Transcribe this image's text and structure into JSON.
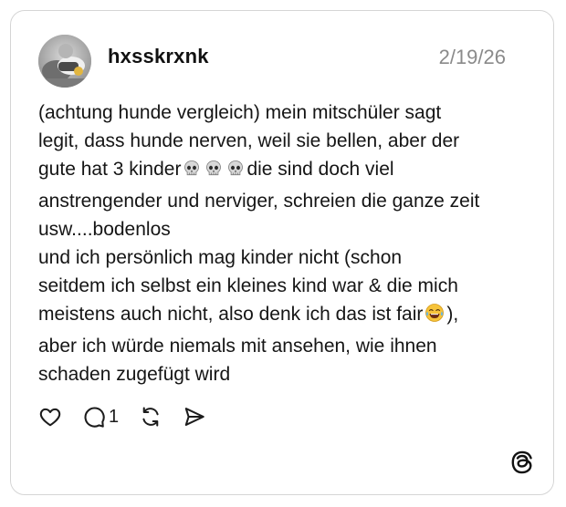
{
  "post": {
    "username": "hxsskrxnk",
    "date": "2/19/26",
    "body": {
      "line1": "(achtung hunde vergleich) mein mitschüler sagt",
      "line2": "legit, dass hunde nerven, weil sie bellen, aber der",
      "line3_before": "gute hat 3 kinder",
      "line3_after": "die sind doch viel",
      "line4": "anstrengender und nerviger, schreien die ganze zeit",
      "line5": "usw....bodenlos",
      "line6": "und ich persönlich mag kinder nicht (schon",
      "line7": "seitdem ich selbst ein kleines kind war & die mich",
      "line8_before": "meistens auch nicht, also denk ich das ist fair",
      "line8_after": "),",
      "line9": "aber ich würde niemals mit ansehen, wie ihnen",
      "line10": "schaden zugefügt wird"
    },
    "emojis": {
      "skull": "skull-emoji",
      "laughing": "face-with-tears-of-joy-emoji"
    }
  },
  "actions": {
    "like_icon": "heart-icon",
    "reply_icon": "comment-icon",
    "reply_count": "1",
    "repost_icon": "repost-icon",
    "share_icon": "send-icon"
  },
  "brand": {
    "logo": "threads-logo-icon"
  },
  "colors": {
    "text": "#151515",
    "date": "#8a8a8a",
    "border": "#d5d5d5",
    "background": "#ffffff"
  }
}
